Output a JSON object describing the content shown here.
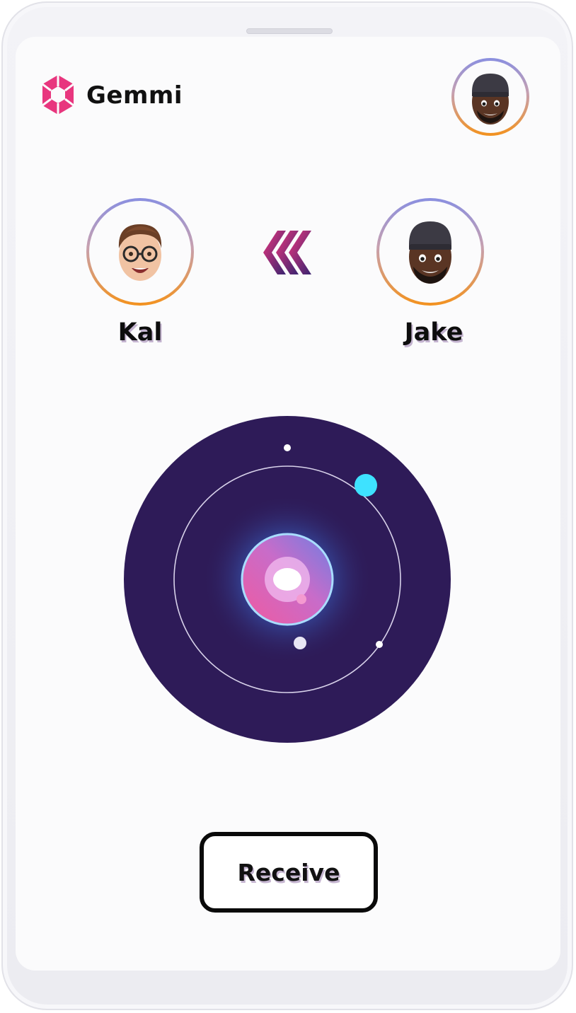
{
  "app": {
    "name": "Gemmi",
    "accent_color": "#e8367e",
    "orbit_background": "#2e1b58"
  },
  "header": {
    "profile_avatar": "jake-memoji-avatar"
  },
  "transfer": {
    "receiver": {
      "name": "Kal",
      "avatar": "kal-memoji-avatar"
    },
    "direction_icon": "triple-chevron-left-icon",
    "sender": {
      "name": "Jake",
      "avatar": "jake-memoji-avatar"
    }
  },
  "actions": {
    "receive_label": "Receive"
  }
}
